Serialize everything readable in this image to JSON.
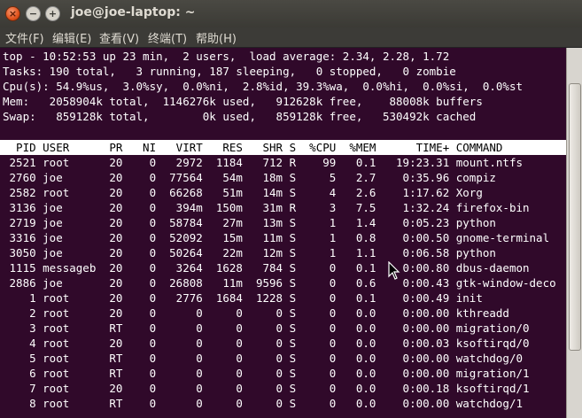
{
  "window": {
    "title": "joe@joe-laptop: ~",
    "close_glyph": "×",
    "minimize_glyph": "−",
    "maximize_glyph": "+"
  },
  "menu": [
    {
      "label": "文件(F)"
    },
    {
      "label": "编辑(E)"
    },
    {
      "label": "查看(V)"
    },
    {
      "label": "终端(T)"
    },
    {
      "label": "帮助(H)"
    }
  ],
  "summary": [
    "top - 10:52:53 up 23 min,  2 users,  load average: 2.34, 2.28, 1.72",
    "Tasks: 190 total,   3 running, 187 sleeping,   0 stopped,   0 zombie",
    "Cpu(s): 54.9%us,  3.0%sy,  0.0%ni,  2.8%id, 39.3%wa,  0.0%hi,  0.0%si,  0.0%st",
    "Mem:   2058904k total,  1146276k used,   912628k free,    88008k buffers",
    "Swap:   859128k total,        0k used,   859128k free,   530492k cached"
  ],
  "columns": [
    "PID",
    "USER",
    "PR",
    "NI",
    "VIRT",
    "RES",
    "SHR",
    "S",
    "%CPU",
    "%MEM",
    "TIME+",
    "COMMAND"
  ],
  "processes": [
    [
      "2521",
      "root",
      "20",
      "0",
      "2972",
      "1184",
      "712",
      "R",
      "99",
      "0.1",
      "19:23.31",
      "mount.ntfs"
    ],
    [
      "2760",
      "joe",
      "20",
      "0",
      "77564",
      "54m",
      "18m",
      "S",
      "5",
      "2.7",
      "0:35.96",
      "compiz"
    ],
    [
      "2582",
      "root",
      "20",
      "0",
      "66268",
      "51m",
      "14m",
      "S",
      "4",
      "2.6",
      "1:17.62",
      "Xorg"
    ],
    [
      "3136",
      "joe",
      "20",
      "0",
      "394m",
      "150m",
      "31m",
      "R",
      "3",
      "7.5",
      "1:32.24",
      "firefox-bin"
    ],
    [
      "2719",
      "joe",
      "20",
      "0",
      "58784",
      "27m",
      "13m",
      "S",
      "1",
      "1.4",
      "0:05.23",
      "python"
    ],
    [
      "3316",
      "joe",
      "20",
      "0",
      "52092",
      "15m",
      "11m",
      "S",
      "1",
      "0.8",
      "0:00.50",
      "gnome-terminal"
    ],
    [
      "3050",
      "joe",
      "20",
      "0",
      "50264",
      "22m",
      "12m",
      "S",
      "1",
      "1.1",
      "0:06.58",
      "python"
    ],
    [
      "1115",
      "messageb",
      "20",
      "0",
      "3264",
      "1628",
      "784",
      "S",
      "0",
      "0.1",
      "0:00.80",
      "dbus-daemon"
    ],
    [
      "2886",
      "joe",
      "20",
      "0",
      "26808",
      "11m",
      "9596",
      "S",
      "0",
      "0.6",
      "0:00.43",
      "gtk-window-deco"
    ],
    [
      "1",
      "root",
      "20",
      "0",
      "2776",
      "1684",
      "1228",
      "S",
      "0",
      "0.1",
      "0:00.49",
      "init"
    ],
    [
      "2",
      "root",
      "20",
      "0",
      "0",
      "0",
      "0",
      "S",
      "0",
      "0.0",
      "0:00.00",
      "kthreadd"
    ],
    [
      "3",
      "root",
      "RT",
      "0",
      "0",
      "0",
      "0",
      "S",
      "0",
      "0.0",
      "0:00.00",
      "migration/0"
    ],
    [
      "4",
      "root",
      "20",
      "0",
      "0",
      "0",
      "0",
      "S",
      "0",
      "0.0",
      "0:00.03",
      "ksoftirqd/0"
    ],
    [
      "5",
      "root",
      "RT",
      "0",
      "0",
      "0",
      "0",
      "S",
      "0",
      "0.0",
      "0:00.00",
      "watchdog/0"
    ],
    [
      "6",
      "root",
      "RT",
      "0",
      "0",
      "0",
      "0",
      "S",
      "0",
      "0.0",
      "0:00.00",
      "migration/1"
    ],
    [
      "7",
      "root",
      "20",
      "0",
      "0",
      "0",
      "0",
      "S",
      "0",
      "0.0",
      "0:00.18",
      "ksoftirqd/1"
    ],
    [
      "8",
      "root",
      "RT",
      "0",
      "0",
      "0",
      "0",
      "S",
      "0",
      "0.0",
      "0:00.00",
      "watchdog/1"
    ]
  ],
  "colors": {
    "terminal_bg": "#30092a",
    "terminal_fg": "#ffffff",
    "header_bg": "#ffffff",
    "header_fg": "#000000"
  }
}
